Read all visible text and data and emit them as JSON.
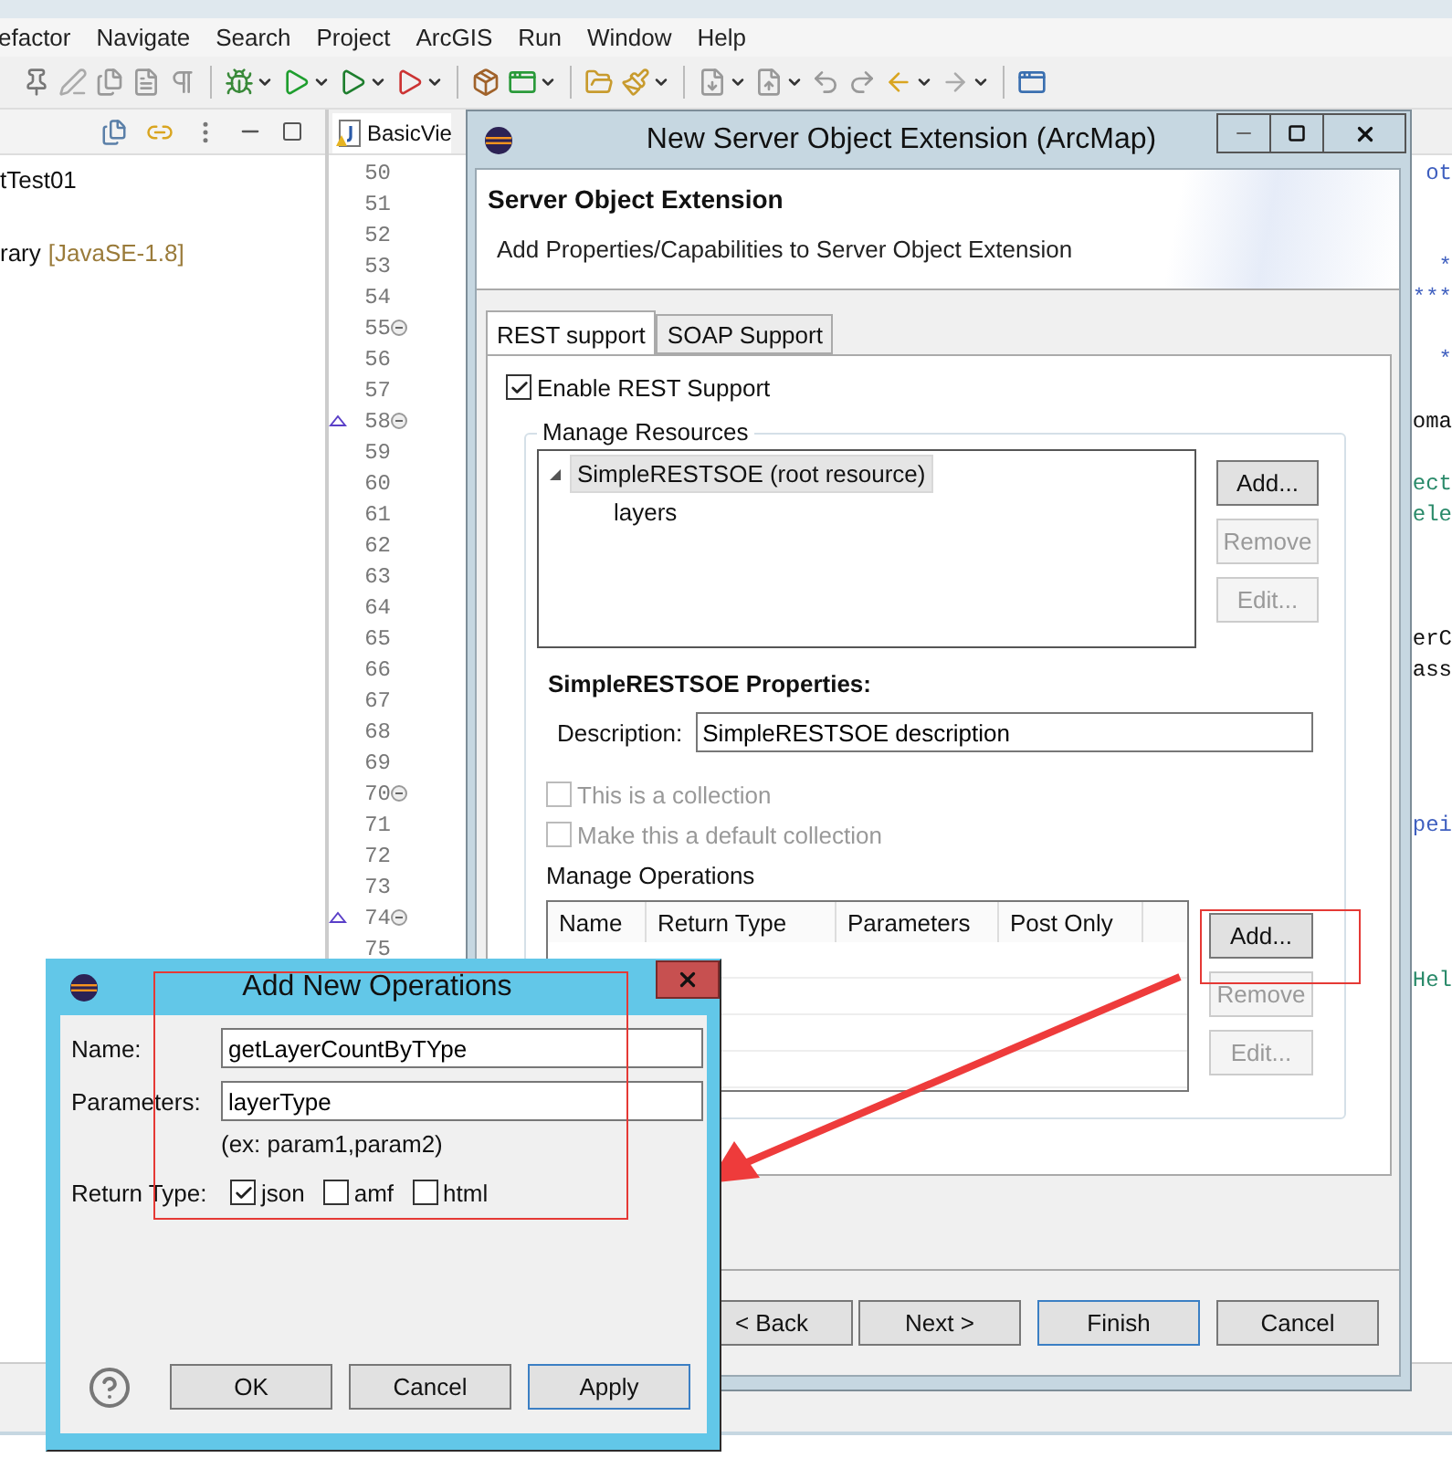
{
  "menu_bar": {
    "items": [
      "efactor",
      "Navigate",
      "Search",
      "Project",
      "ArcGIS",
      "Run",
      "Window",
      "Help"
    ]
  },
  "package_explorer": {
    "items": [
      {
        "text": "tTest01"
      },
      {
        "text": "rary",
        "decoration": "[JavaSE-1.8]"
      }
    ]
  },
  "editor": {
    "tab": "BasicVie",
    "lines": [
      {
        "number": "50",
        "fold": false,
        "override": false,
        "code": "ot",
        "color": "#3f5fbf"
      },
      {
        "number": "51",
        "fold": false,
        "override": false
      },
      {
        "number": "52",
        "fold": false,
        "override": false
      },
      {
        "number": "53",
        "fold": false,
        "override": false,
        "code": "*",
        "color": "#3f5fbf"
      },
      {
        "number": "54",
        "fold": false,
        "override": false,
        "code": "***",
        "color": "#3f5fbf"
      },
      {
        "number": "55",
        "fold": true,
        "override": false
      },
      {
        "number": "56",
        "fold": false,
        "override": false,
        "code": "*",
        "color": "#3f5fbf"
      },
      {
        "number": "57",
        "fold": false,
        "override": false
      },
      {
        "number": "58",
        "fold": true,
        "override": true,
        "code": "oma",
        "color": "#111111"
      },
      {
        "number": "59",
        "fold": false,
        "override": false
      },
      {
        "number": "60",
        "fold": false,
        "override": false,
        "code": "ect",
        "color": "#2a8a6a"
      },
      {
        "number": "61",
        "fold": false,
        "override": false,
        "code": "ele",
        "color": "#2a8a6a"
      },
      {
        "number": "62",
        "fold": false,
        "override": false
      },
      {
        "number": "63",
        "fold": false,
        "override": false
      },
      {
        "number": "64",
        "fold": false,
        "override": false
      },
      {
        "number": "65",
        "fold": false,
        "override": false,
        "code": "erC",
        "color": "#111111"
      },
      {
        "number": "66",
        "fold": false,
        "override": false,
        "code": "ass",
        "color": "#111111"
      },
      {
        "number": "67",
        "fold": false,
        "override": false
      },
      {
        "number": "68",
        "fold": false,
        "override": false
      },
      {
        "number": "69",
        "fold": false,
        "override": false
      },
      {
        "number": "70",
        "fold": true,
        "override": false
      },
      {
        "number": "71",
        "fold": false,
        "override": false,
        "code": "pei",
        "color": "#3f5fbf"
      },
      {
        "number": "72",
        "fold": false,
        "override": false
      },
      {
        "number": "73",
        "fold": false,
        "override": false
      },
      {
        "number": "74",
        "fold": true,
        "override": true
      },
      {
        "number": "75",
        "fold": false,
        "override": false
      },
      {
        "fold": false,
        "override": false,
        "code": "Hel",
        "color": "#2a8a6a"
      }
    ]
  },
  "main_dialog": {
    "title": "New Server Object Extension (ArcMap)",
    "header_title": "Server Object Extension",
    "header_subtitle": "Add Properties/Capabilities to Server Object Extension",
    "tabs": [
      {
        "label": "REST support",
        "selected": true
      },
      {
        "label": "SOAP Support",
        "selected": false
      }
    ],
    "enable_rest": {
      "label": "Enable REST Support",
      "checked": true
    },
    "resources": {
      "title": "Manage Resources",
      "tree": [
        {
          "label": "SimpleRESTSOE (root resource)",
          "expanded": true,
          "selected": true,
          "children": [
            {
              "label": "layers",
              "selected": false
            }
          ]
        }
      ],
      "buttons": [
        {
          "label": "Add...",
          "disabled": false
        },
        {
          "label": "Remove",
          "disabled": true
        },
        {
          "label": "Edit...",
          "disabled": true
        }
      ]
    },
    "properties_title": "SimpleRESTSOE Properties:",
    "description": {
      "label": "Description:",
      "value": "SimpleRESTSOE description"
    },
    "options": [
      {
        "label": "This is a collection",
        "checked": false,
        "disabled": true
      },
      {
        "label": "Make this a default collection",
        "checked": false,
        "disabled": true
      }
    ],
    "operations": {
      "title": "Manage Operations",
      "columns": [
        "Name",
        "Return Type",
        "Parameters",
        "Post Only"
      ],
      "buttons": [
        {
          "label": "Add...",
          "disabled": false
        },
        {
          "label": "Remove",
          "disabled": true
        },
        {
          "label": "Edit...",
          "disabled": true
        }
      ]
    },
    "footer_buttons": [
      {
        "label": "< Back",
        "default": false
      },
      {
        "label": "Next >",
        "default": false
      },
      {
        "label": "Finish",
        "default": true
      },
      {
        "label": "Cancel",
        "default": false
      }
    ]
  },
  "operations_dialog": {
    "title": "Add New Operations",
    "fields": [
      {
        "label": "Name:",
        "value": "getLayerCountByTYpe"
      },
      {
        "label": "Parameters:",
        "value": "layerType"
      }
    ],
    "hint": "(ex: param1,param2)",
    "return_type": {
      "label": "Return Type:",
      "options": [
        {
          "label": "json",
          "checked": true
        },
        {
          "label": "amf",
          "checked": false
        },
        {
          "label": "html",
          "checked": false
        }
      ]
    },
    "buttons": [
      {
        "label": "OK",
        "default": false
      },
      {
        "label": "Cancel",
        "default": false
      },
      {
        "label": "Apply",
        "default": true
      }
    ]
  }
}
